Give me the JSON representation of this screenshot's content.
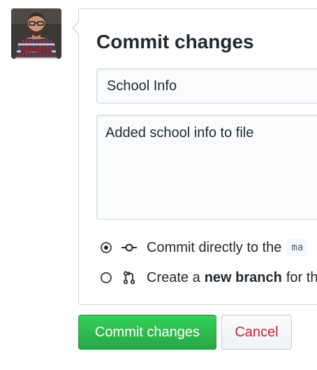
{
  "avatar": {
    "alt": "User avatar"
  },
  "commit_form": {
    "title": "Commit changes",
    "summary_value": "School Info",
    "description_value": "Added school info to file",
    "option_direct": {
      "text": "Commit directly to the",
      "branch": "ma",
      "selected": true
    },
    "option_new_branch": {
      "prefix": "Create a",
      "bold": "new branch",
      "suffix": "for th",
      "selected": false
    }
  },
  "buttons": {
    "commit_label": "Commit changes",
    "cancel_label": "Cancel"
  },
  "colors": {
    "primary": "#28a745",
    "danger": "#cb2431",
    "border": "#d1d5da"
  }
}
